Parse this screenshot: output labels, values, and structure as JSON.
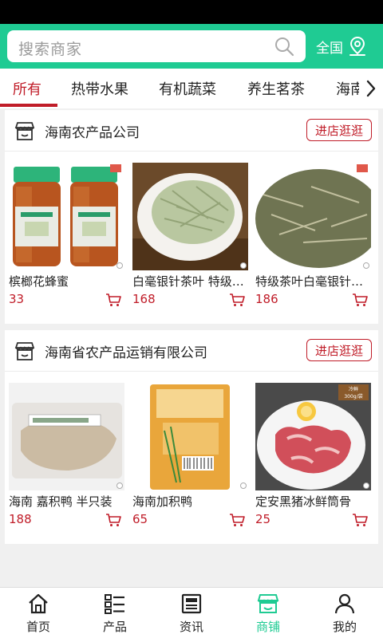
{
  "colors": {
    "accent": "#1fcb93",
    "price": "#c01c28",
    "text": "#222222"
  },
  "search": {
    "placeholder": "搜索商家",
    "icon": "search-icon"
  },
  "region": {
    "label": "全国",
    "icon": "location-pin-icon"
  },
  "tabs": [
    {
      "label": "所有",
      "active": true
    },
    {
      "label": "热带水果"
    },
    {
      "label": "有机蔬菜"
    },
    {
      "label": "养生茗茶"
    },
    {
      "label": "海南"
    }
  ],
  "shops": [
    {
      "name": "海南农产品公司",
      "visit_label": "进店逛逛",
      "products": [
        {
          "name": "槟榔花蜂蜜",
          "price": "33"
        },
        {
          "name": "白毫银针茶叶 特级散装",
          "price": "168"
        },
        {
          "name": "特级茶叶白毫银针散装",
          "price": "186"
        }
      ]
    },
    {
      "name": "海南省农产品运销有限公司",
      "visit_label": "进店逛逛",
      "products": [
        {
          "name": "海南 嘉积鸭 半只装",
          "price": "188"
        },
        {
          "name": "海南加积鸭",
          "price": "65"
        },
        {
          "name": "定安黑猪冰鲜筒骨",
          "price": "25"
        }
      ]
    }
  ],
  "bottom_nav": [
    {
      "label": "首页",
      "icon": "home-icon"
    },
    {
      "label": "产品",
      "icon": "list-icon"
    },
    {
      "label": "资讯",
      "icon": "news-icon"
    },
    {
      "label": "商铺",
      "icon": "shop-icon",
      "active": true
    },
    {
      "label": "我的",
      "icon": "user-icon"
    }
  ],
  "image_labels": {
    "pork_pack": "300g/袋",
    "pork_tag": "冷鲜"
  }
}
